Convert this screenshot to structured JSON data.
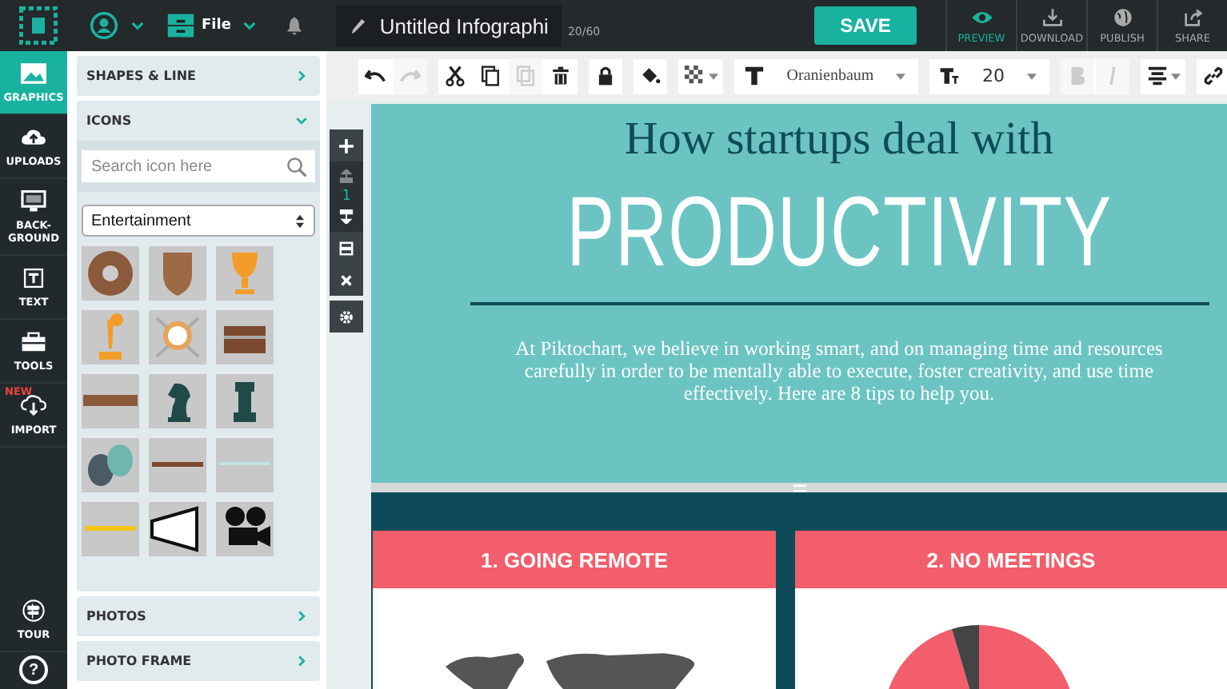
{
  "topbar": {
    "file_menu": "File",
    "document_title": "Untitled Infographi",
    "counter": "20/60",
    "save": "SAVE",
    "actions": [
      {
        "label": "PREVIEW",
        "kind": "eye",
        "selected": true
      },
      {
        "label": "DOWNLOAD",
        "kind": "download",
        "selected": false
      },
      {
        "label": "PUBLISH",
        "kind": "globe",
        "selected": false
      },
      {
        "label": "SHARE",
        "kind": "share",
        "selected": false
      }
    ]
  },
  "rail": {
    "items": [
      {
        "lines": [
          "GRAPHICS"
        ],
        "kind": "image",
        "selected": true
      },
      {
        "lines": [
          "UPLOADS"
        ],
        "kind": "cloud-up",
        "selected": false
      },
      {
        "lines": [
          "BACK-",
          "GROUND"
        ],
        "kind": "monitor",
        "selected": false
      },
      {
        "lines": [
          "TEXT"
        ],
        "kind": "text",
        "selected": false
      },
      {
        "lines": [
          "TOOLS"
        ],
        "kind": "toolbox",
        "selected": false
      },
      {
        "lines": [
          "IMPORT"
        ],
        "kind": "cloud-down",
        "selected": false,
        "badge": "NEW"
      }
    ],
    "tour": "TOUR",
    "help": "?"
  },
  "panel": {
    "sections": [
      {
        "title": "SHAPES & LINE",
        "expanded": false
      },
      {
        "title": "ICONS",
        "expanded": true
      },
      {
        "title": "PHOTOS",
        "expanded": false
      },
      {
        "title": "PHOTO FRAME",
        "expanded": false
      }
    ],
    "search": {
      "placeholder": "Search icon here"
    },
    "category": "Entertainment"
  },
  "toolbar": {
    "font": "Oranienbaum",
    "size": "20",
    "bold_disabled": true,
    "italic_disabled": true,
    "redo_disabled": true,
    "paste_disabled": true
  },
  "page_tools": {
    "page": "1"
  },
  "canvas": {
    "heading": "How startups deal with",
    "title": "PRODUCTIVITY",
    "intro": "At Piktochart, we believe in working smart, and on managing time and resources carefully in order to be mentally able to execute, foster creativity, and use time effectively. Here are 8 tips to help you.",
    "sections": [
      {
        "title": "1. GOING REMOTE",
        "kind": "map"
      },
      {
        "title": "2. NO MEETINGS",
        "kind": "pie"
      }
    ]
  }
}
